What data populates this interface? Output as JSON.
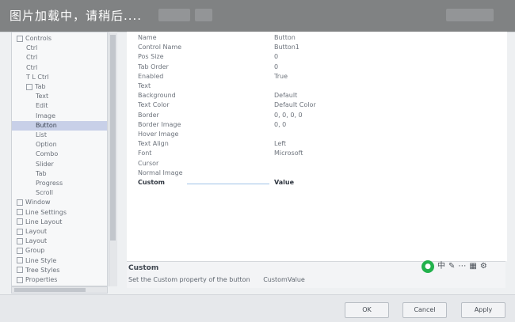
{
  "banner": {
    "text": "图片加载中，请稍后...."
  },
  "tree": {
    "items": [
      {
        "label": "Controls",
        "indent": 0,
        "expander": true
      },
      {
        "label": "Ctrl",
        "indent": 1
      },
      {
        "label": "Ctrl",
        "indent": 1
      },
      {
        "label": "Ctrl",
        "indent": 1
      },
      {
        "label": "T  L  Ctrl",
        "indent": 1
      },
      {
        "label": "Tab",
        "indent": 1,
        "expander": true
      },
      {
        "label": "Text",
        "indent": 2
      },
      {
        "label": "Edit",
        "indent": 2
      },
      {
        "label": "Image",
        "indent": 2
      },
      {
        "label": "Button",
        "indent": 2,
        "selected": true
      },
      {
        "label": "List",
        "indent": 2
      },
      {
        "label": "Option",
        "indent": 2
      },
      {
        "label": "Combo",
        "indent": 2
      },
      {
        "label": "Slider",
        "indent": 2
      },
      {
        "label": "Tab",
        "indent": 2
      },
      {
        "label": "Progress",
        "indent": 2
      },
      {
        "label": "Scroll",
        "indent": 2
      },
      {
        "label": "Window",
        "indent": 0,
        "expander": true
      },
      {
        "label": "Line Settings",
        "indent": 0,
        "expander": true
      },
      {
        "label": "Line Layout",
        "indent": 0,
        "expander": true
      },
      {
        "label": "Layout",
        "indent": 0,
        "expander": true
      },
      {
        "label": "Layout",
        "indent": 0,
        "expander": true
      },
      {
        "label": "Group",
        "indent": 0,
        "expander": true
      },
      {
        "label": "Line Style",
        "indent": 0,
        "expander": true
      },
      {
        "label": "Tree Styles",
        "indent": 0,
        "expander": true
      },
      {
        "label": "Properties",
        "indent": 0,
        "expander": true
      }
    ]
  },
  "grid": {
    "rows": [
      {
        "name": "Name",
        "value": "Button"
      },
      {
        "name": "Control Name",
        "value": "Button1"
      },
      {
        "name": "Pos  Size",
        "value": "0"
      },
      {
        "name": "Tab Order",
        "value": "0"
      },
      {
        "name": "Enabled",
        "value": "True"
      },
      {
        "name": "Text",
        "value": ""
      },
      {
        "name": "Background",
        "value": "Default"
      },
      {
        "name": "Text Color",
        "value": "Default Color"
      },
      {
        "name": "Border",
        "value": "0, 0, 0, 0"
      },
      {
        "name": "Border Image",
        "value": "0, 0"
      },
      {
        "name": "Hover Image",
        "value": ""
      },
      {
        "name": "Text Align",
        "value": "Left"
      },
      {
        "name": "Font",
        "value": "Microsoft"
      },
      {
        "name": "Cursor",
        "value": ""
      },
      {
        "name": "Normal Image",
        "value": ""
      },
      {
        "name": "Custom",
        "value": "Value",
        "selected": true
      }
    ]
  },
  "description": {
    "title": "Custom",
    "text": "Set the Custom property of the button",
    "value": "CustomValue"
  },
  "tray": {
    "icons": [
      "wechat-icon",
      "lang-icon",
      "pen-icon",
      "dots-icon",
      "keyboard-icon",
      "settings-icon"
    ]
  },
  "buttons": {
    "ok": "OK",
    "cancel": "Cancel",
    "apply": "Apply"
  }
}
